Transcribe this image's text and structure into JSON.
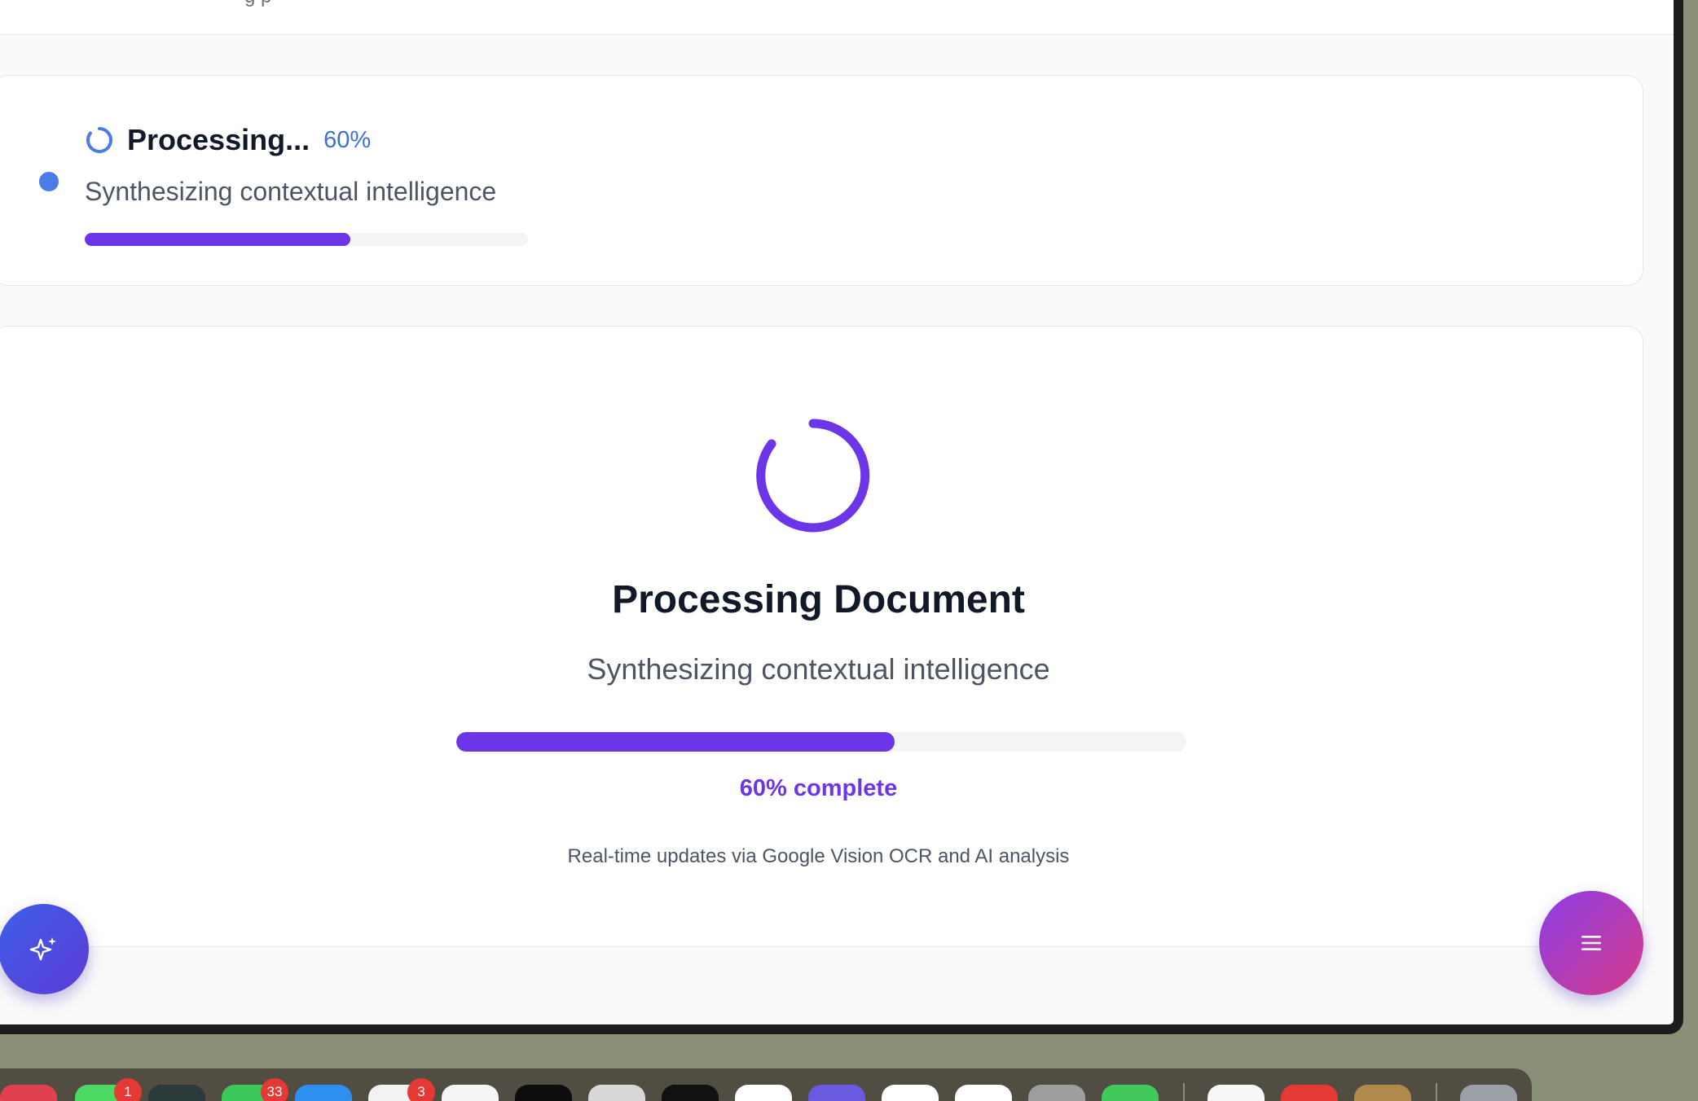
{
  "header": {
    "cut_text": "g                              p"
  },
  "status": {
    "title": "Processing...",
    "percent": "60%",
    "subtitle": "Synthesizing contextual intelligence",
    "progress": 0.6
  },
  "processing": {
    "title": "Processing Document",
    "subtitle": "Synthesizing contextual intelligence",
    "progress": 0.6,
    "complete_label": "60% complete",
    "footnote": "Real-time updates via Google Vision OCR and AI analysis"
  },
  "fab": {
    "ai_icon": "sparkles-icon",
    "menu_icon": "menu-icon"
  },
  "dock": {
    "apps": [
      {
        "name": "dock-app-1",
        "color": "#e0414f",
        "badge": ""
      },
      {
        "name": "dock-app-2",
        "color": "#4cd964",
        "badge": "1"
      },
      {
        "name": "dock-app-3",
        "color": "#2b3a3a",
        "badge": ""
      },
      {
        "name": "dock-app-4",
        "color": "#3cc85a",
        "badge": "33"
      },
      {
        "name": "dock-app-5",
        "color": "#2d8ff0",
        "badge": ""
      },
      {
        "name": "dock-app-6",
        "color": "#f2f2f2",
        "badge": "3"
      },
      {
        "name": "dock-app-7",
        "color": "#f5f5f5",
        "badge": ""
      },
      {
        "name": "dock-app-8",
        "color": "#0d0d0d",
        "badge": ""
      },
      {
        "name": "dock-app-9",
        "color": "#d8d8d8",
        "badge": ""
      },
      {
        "name": "dock-app-10",
        "color": "#111111",
        "badge": ""
      },
      {
        "name": "dock-app-11",
        "color": "#ffffff",
        "badge": ""
      },
      {
        "name": "dock-app-12",
        "color": "#6a5ae0",
        "badge": ""
      },
      {
        "name": "dock-app-13",
        "color": "#ffffff",
        "badge": ""
      },
      {
        "name": "dock-app-14",
        "color": "#ffffff",
        "badge": ""
      },
      {
        "name": "dock-app-15",
        "color": "#9e9e9e",
        "badge": ""
      },
      {
        "name": "dock-app-16",
        "color": "#41c95b",
        "badge": ""
      },
      {
        "name": "dock-app-17",
        "color": "#f7f7f7",
        "badge": ""
      },
      {
        "name": "dock-app-18",
        "color": "#e53935",
        "badge": ""
      },
      {
        "name": "dock-app-19",
        "color": "#b08a4a",
        "badge": ""
      },
      {
        "name": "dock-trash",
        "color": "#9aa0a6",
        "badge": ""
      }
    ]
  }
}
